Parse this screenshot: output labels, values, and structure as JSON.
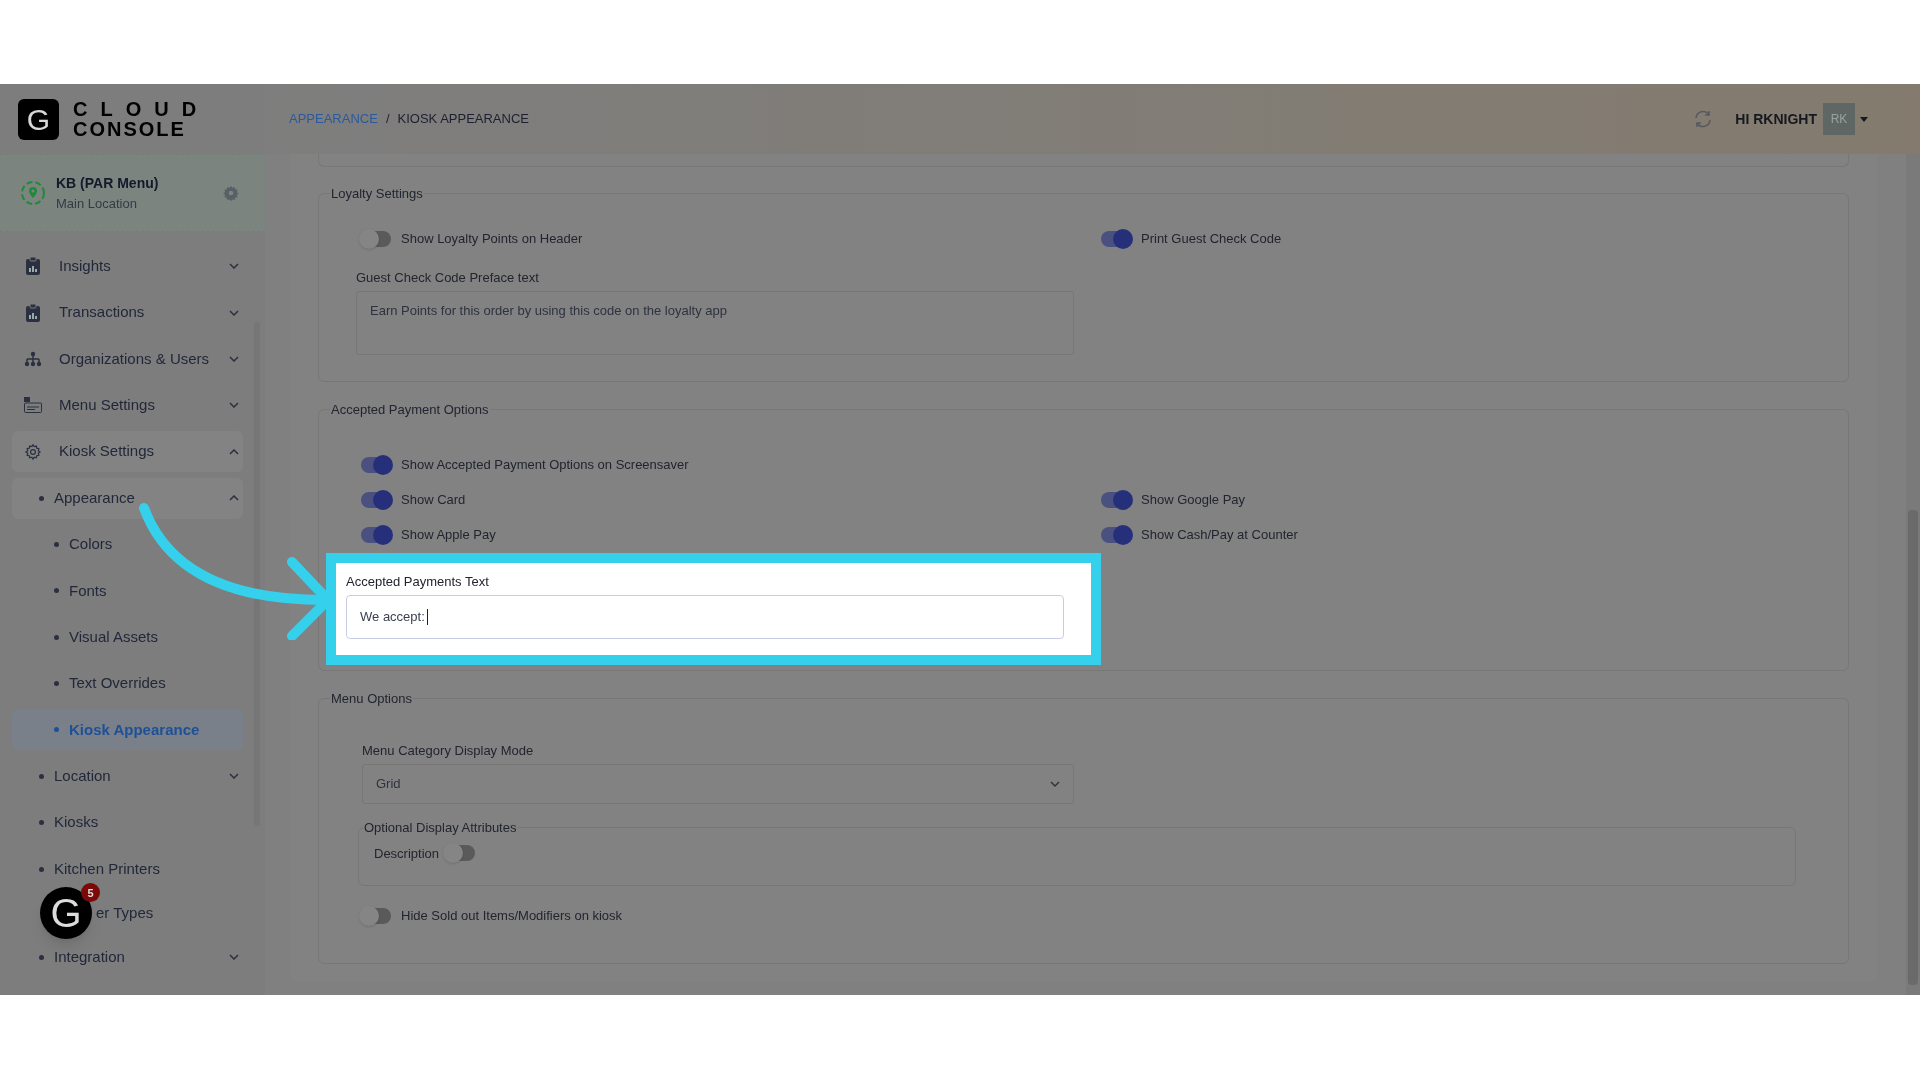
{
  "logo": {
    "mark": "G",
    "line1": "CLOUD",
    "line2": "CONSOLE"
  },
  "location": {
    "name": "KB (PAR Menu)",
    "subtitle": "Main Location"
  },
  "nav": [
    {
      "label": "Insights",
      "expanded": false,
      "selected": false
    },
    {
      "label": "Transactions",
      "expanded": false,
      "selected": false
    },
    {
      "label": "Organizations & Users",
      "expanded": false,
      "selected": false
    },
    {
      "label": "Menu Settings",
      "expanded": false,
      "selected": false
    },
    {
      "label": "Kiosk Settings",
      "expanded": true,
      "selected": false,
      "children": [
        {
          "label": "Appearance",
          "expanded": true,
          "selected": false,
          "children": [
            {
              "label": "Colors",
              "selected": false
            },
            {
              "label": "Fonts",
              "selected": false
            },
            {
              "label": "Visual Assets",
              "selected": false
            },
            {
              "label": "Text Overrides",
              "selected": false
            },
            {
              "label": "Kiosk Appearance",
              "selected": true
            }
          ]
        },
        {
          "label": "Location",
          "expanded": false,
          "selected": false
        },
        {
          "label": "Kiosks",
          "selected": false
        },
        {
          "label": "Kitchen Printers",
          "selected": false
        },
        {
          "label": "er Types",
          "selected": false,
          "covered_by_help_button": true
        },
        {
          "label": "Integration",
          "expanded": false,
          "selected": false
        }
      ]
    }
  ],
  "help_button": {
    "mark": "G",
    "count": "5"
  },
  "breadcrumb": {
    "items": [
      {
        "label": "APPEARANCE",
        "link": true
      },
      {
        "label": "KIOSK APPEARANCE",
        "link": false
      }
    ],
    "separator": "/"
  },
  "user": {
    "greeting": "HI RKNIGHT",
    "initials": "RK"
  },
  "sections": [
    {
      "title": "Loyalty Settings",
      "items": [
        {
          "kind": "toggle-pair",
          "left": {
            "label": "Show Loyalty Points on Header",
            "on": false
          },
          "right": {
            "label": "Print Guest Check Code",
            "on": true
          }
        },
        {
          "kind": "textarea",
          "label": "Guest Check Code Preface text",
          "value": "Earn Points for this order by using this code on the loyalty app"
        }
      ]
    },
    {
      "title": "Accepted Payment Options",
      "items": [
        {
          "kind": "toggle-pair",
          "left": {
            "label": "Show Accepted Payment Options on Screensaver",
            "on": true
          }
        },
        {
          "kind": "toggle-pair",
          "left": {
            "label": "Show Card",
            "on": true
          },
          "right": {
            "label": "Show Google Pay",
            "on": true
          }
        },
        {
          "kind": "toggle-pair",
          "left": {
            "label": "Show Apple Pay",
            "on": true
          },
          "right": {
            "label": "Show Cash/Pay at Counter",
            "on": true
          }
        },
        {
          "kind": "input",
          "label": "Accepted Payments Text",
          "value": "We accept:",
          "highlighted": true,
          "focused": true
        }
      ]
    },
    {
      "title": "Menu Options",
      "items": [
        {
          "kind": "select",
          "label": "Menu Category Display Mode",
          "value": "Grid"
        },
        {
          "kind": "group",
          "title": "Optional Display Attributes",
          "items": [
            {
              "kind": "inline-toggle",
              "label": "Description",
              "on": false
            }
          ]
        },
        {
          "kind": "toggle-pair",
          "left": {
            "label": "Hide Sold out Items/Modifiers on kiosk",
            "on": false
          }
        }
      ]
    }
  ]
}
